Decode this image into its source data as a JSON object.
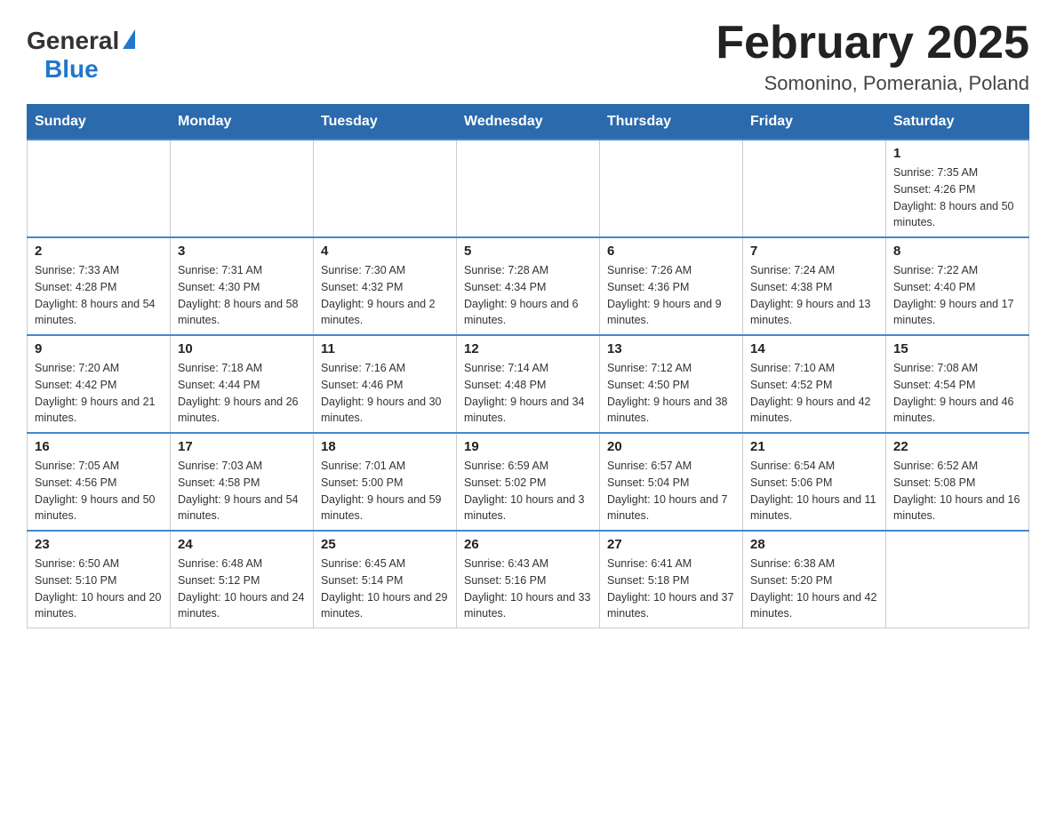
{
  "header": {
    "logo": {
      "general": "General",
      "blue": "Blue"
    },
    "title": "February 2025",
    "subtitle": "Somonino, Pomerania, Poland"
  },
  "weekdays": [
    "Sunday",
    "Monday",
    "Tuesday",
    "Wednesday",
    "Thursday",
    "Friday",
    "Saturday"
  ],
  "weeks": [
    [
      {
        "day": "",
        "info": ""
      },
      {
        "day": "",
        "info": ""
      },
      {
        "day": "",
        "info": ""
      },
      {
        "day": "",
        "info": ""
      },
      {
        "day": "",
        "info": ""
      },
      {
        "day": "",
        "info": ""
      },
      {
        "day": "1",
        "info": "Sunrise: 7:35 AM\nSunset: 4:26 PM\nDaylight: 8 hours and 50 minutes."
      }
    ],
    [
      {
        "day": "2",
        "info": "Sunrise: 7:33 AM\nSunset: 4:28 PM\nDaylight: 8 hours and 54 minutes."
      },
      {
        "day": "3",
        "info": "Sunrise: 7:31 AM\nSunset: 4:30 PM\nDaylight: 8 hours and 58 minutes."
      },
      {
        "day": "4",
        "info": "Sunrise: 7:30 AM\nSunset: 4:32 PM\nDaylight: 9 hours and 2 minutes."
      },
      {
        "day": "5",
        "info": "Sunrise: 7:28 AM\nSunset: 4:34 PM\nDaylight: 9 hours and 6 minutes."
      },
      {
        "day": "6",
        "info": "Sunrise: 7:26 AM\nSunset: 4:36 PM\nDaylight: 9 hours and 9 minutes."
      },
      {
        "day": "7",
        "info": "Sunrise: 7:24 AM\nSunset: 4:38 PM\nDaylight: 9 hours and 13 minutes."
      },
      {
        "day": "8",
        "info": "Sunrise: 7:22 AM\nSunset: 4:40 PM\nDaylight: 9 hours and 17 minutes."
      }
    ],
    [
      {
        "day": "9",
        "info": "Sunrise: 7:20 AM\nSunset: 4:42 PM\nDaylight: 9 hours and 21 minutes."
      },
      {
        "day": "10",
        "info": "Sunrise: 7:18 AM\nSunset: 4:44 PM\nDaylight: 9 hours and 26 minutes."
      },
      {
        "day": "11",
        "info": "Sunrise: 7:16 AM\nSunset: 4:46 PM\nDaylight: 9 hours and 30 minutes."
      },
      {
        "day": "12",
        "info": "Sunrise: 7:14 AM\nSunset: 4:48 PM\nDaylight: 9 hours and 34 minutes."
      },
      {
        "day": "13",
        "info": "Sunrise: 7:12 AM\nSunset: 4:50 PM\nDaylight: 9 hours and 38 minutes."
      },
      {
        "day": "14",
        "info": "Sunrise: 7:10 AM\nSunset: 4:52 PM\nDaylight: 9 hours and 42 minutes."
      },
      {
        "day": "15",
        "info": "Sunrise: 7:08 AM\nSunset: 4:54 PM\nDaylight: 9 hours and 46 minutes."
      }
    ],
    [
      {
        "day": "16",
        "info": "Sunrise: 7:05 AM\nSunset: 4:56 PM\nDaylight: 9 hours and 50 minutes."
      },
      {
        "day": "17",
        "info": "Sunrise: 7:03 AM\nSunset: 4:58 PM\nDaylight: 9 hours and 54 minutes."
      },
      {
        "day": "18",
        "info": "Sunrise: 7:01 AM\nSunset: 5:00 PM\nDaylight: 9 hours and 59 minutes."
      },
      {
        "day": "19",
        "info": "Sunrise: 6:59 AM\nSunset: 5:02 PM\nDaylight: 10 hours and 3 minutes."
      },
      {
        "day": "20",
        "info": "Sunrise: 6:57 AM\nSunset: 5:04 PM\nDaylight: 10 hours and 7 minutes."
      },
      {
        "day": "21",
        "info": "Sunrise: 6:54 AM\nSunset: 5:06 PM\nDaylight: 10 hours and 11 minutes."
      },
      {
        "day": "22",
        "info": "Sunrise: 6:52 AM\nSunset: 5:08 PM\nDaylight: 10 hours and 16 minutes."
      }
    ],
    [
      {
        "day": "23",
        "info": "Sunrise: 6:50 AM\nSunset: 5:10 PM\nDaylight: 10 hours and 20 minutes."
      },
      {
        "day": "24",
        "info": "Sunrise: 6:48 AM\nSunset: 5:12 PM\nDaylight: 10 hours and 24 minutes."
      },
      {
        "day": "25",
        "info": "Sunrise: 6:45 AM\nSunset: 5:14 PM\nDaylight: 10 hours and 29 minutes."
      },
      {
        "day": "26",
        "info": "Sunrise: 6:43 AM\nSunset: 5:16 PM\nDaylight: 10 hours and 33 minutes."
      },
      {
        "day": "27",
        "info": "Sunrise: 6:41 AM\nSunset: 5:18 PM\nDaylight: 10 hours and 37 minutes."
      },
      {
        "day": "28",
        "info": "Sunrise: 6:38 AM\nSunset: 5:20 PM\nDaylight: 10 hours and 42 minutes."
      },
      {
        "day": "",
        "info": ""
      }
    ]
  ]
}
